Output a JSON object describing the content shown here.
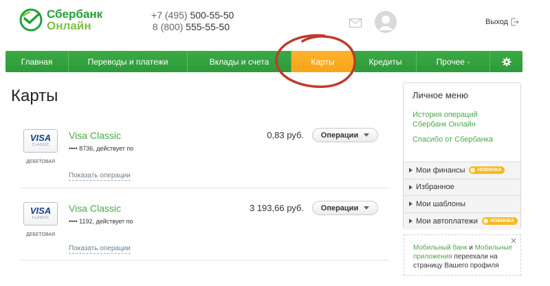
{
  "header": {
    "logo_line1": "Сбербанк",
    "logo_line2": "Онлайн",
    "phone1_prefix": "+7 (495)",
    "phone1_number": "500-55-50",
    "phone2_prefix": "8 (800)",
    "phone2_number": "555-55-50",
    "logout_label": "Выход"
  },
  "nav": {
    "items": [
      {
        "label": "Главная"
      },
      {
        "label": "Переводы и платежи"
      },
      {
        "label": "Вклады и счета"
      },
      {
        "label": "Карты"
      },
      {
        "label": "Кредиты"
      },
      {
        "label": "Прочее -"
      }
    ],
    "active_index": 3
  },
  "main": {
    "title": "Карты",
    "cards": [
      {
        "brand": "VISA",
        "brand_sub": "CLASSIC",
        "type_label": "ДЕБЕТОВАЯ",
        "name": "Visa Classic",
        "number_text": "•••• 8736, действует по",
        "amount": "0,83 руб.",
        "ops_label": "Операции",
        "show_ops_label": "Показать операции"
      },
      {
        "brand": "VISA",
        "brand_sub": "CLASSIC",
        "type_label": "ДЕБЕТОВАЯ",
        "name": "Visa Classic",
        "number_text": "•••• 1192, действует по",
        "amount": "3 193,66 руб.",
        "ops_label": "Операции",
        "show_ops_label": "Показать операции"
      }
    ]
  },
  "sidebar": {
    "title": "Личное меню",
    "links": [
      {
        "label": "История операций Сбербанк Онлайн"
      },
      {
        "label": "Спасибо от Сбербанка"
      }
    ],
    "items": [
      {
        "label": "Мои финансы",
        "badge": "НОВИНКА"
      },
      {
        "label": "Избранное",
        "badge": ""
      },
      {
        "label": "Мои шаблоны",
        "badge": ""
      },
      {
        "label": "Мои автоплатежи",
        "badge": "НОВИНКА"
      }
    ]
  },
  "notice": {
    "link1": "Мобильный банк",
    "and": "и",
    "link2": "Мобильные приложения",
    "text": "переехали на страницу Вашего профиля"
  },
  "colors": {
    "brand_green": "#21a038",
    "nav_green": "#3aaa45",
    "nav_active_orange": "#f7a51a",
    "link_green": "#4aa84a",
    "annotation_red": "#c0392b",
    "badge_yellow": "#f7b91e"
  }
}
